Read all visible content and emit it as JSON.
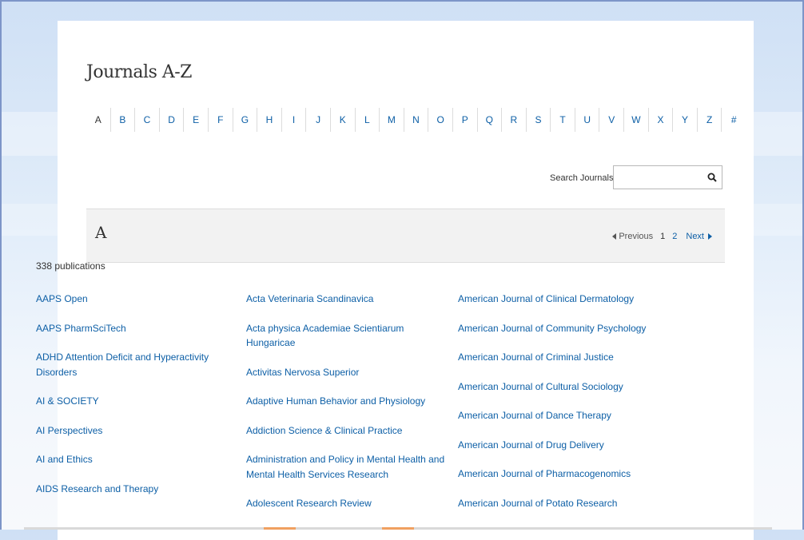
{
  "page": {
    "title": "Journals A-Z"
  },
  "alphabet": [
    "A",
    "B",
    "C",
    "D",
    "E",
    "F",
    "G",
    "H",
    "I",
    "J",
    "K",
    "L",
    "M",
    "N",
    "O",
    "P",
    "Q",
    "R",
    "S",
    "T",
    "U",
    "V",
    "W",
    "X",
    "Y",
    "Z",
    "#"
  ],
  "search": {
    "label": "Search Journals",
    "value": "",
    "icon": "search-icon"
  },
  "section": {
    "letter": "A",
    "pager": {
      "previous_label": "Previous",
      "pages": [
        "1",
        "2"
      ],
      "current_page": "1",
      "next_label": "Next"
    },
    "count_text": "338 publications"
  },
  "journals": {
    "col1": [
      "AAPS Open",
      "AAPS PharmSciTech",
      "ADHD Attention Deficit and Hyperactivity Disorders",
      "AI & SOCIETY",
      "AI Perspectives",
      "AI and Ethics",
      "AIDS Research and Therapy"
    ],
    "col2": [
      "Acta Veterinaria Scandinavica",
      "Acta physica Academiae Scientiarum Hungaricae",
      "Activitas Nervosa Superior",
      "Adaptive Human Behavior and Physiology",
      "Addiction Science & Clinical Practice",
      "Administration and Policy in Mental Health and Mental Health Services Research",
      "Adolescent Research Review"
    ],
    "col3": [
      "American Journal of Clinical Dermatology",
      "American Journal of Community Psychology",
      "American Journal of Criminal Justice",
      "American Journal of Cultural Sociology",
      "American Journal of Dance Therapy",
      "American Journal of Drug Delivery",
      "American Journal of Pharmacogenomics",
      "American Journal of Potato Research"
    ]
  },
  "colors": {
    "link": "#0d5fa6",
    "text": "#333333",
    "header_bg": "#f2f2f2"
  }
}
